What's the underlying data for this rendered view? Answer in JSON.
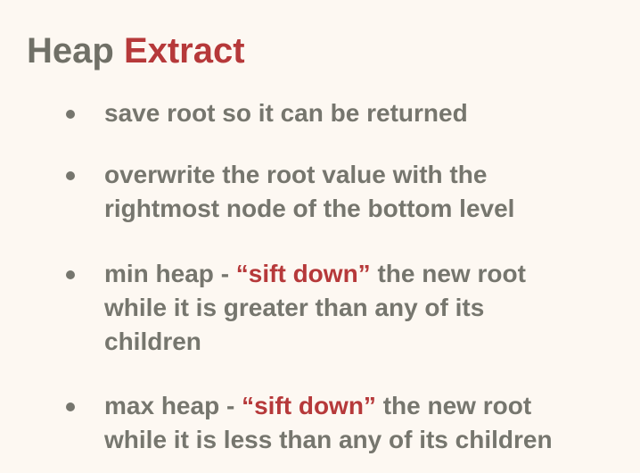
{
  "title": {
    "part1": "Heap ",
    "part2": "Extract"
  },
  "bullets": [
    {
      "lines": [
        "save root so it can be returned"
      ]
    },
    {
      "lines": [
        "overwrite the root value with the",
        "rightmost node of the bottom level"
      ]
    },
    {
      "prefix": "min heap - ",
      "highlight": "“sift down”",
      "suffix": " the new root",
      "lines": [
        "while it is greater than any of its",
        "children"
      ]
    },
    {
      "prefix": "max heap - ",
      "highlight": "“sift down”",
      "suffix": " the new root",
      "lines": [
        "while it is less than any of its children"
      ]
    }
  ],
  "colors": {
    "background": "#fdf8f2",
    "text": "#76766e",
    "accent": "#b6393a"
  }
}
